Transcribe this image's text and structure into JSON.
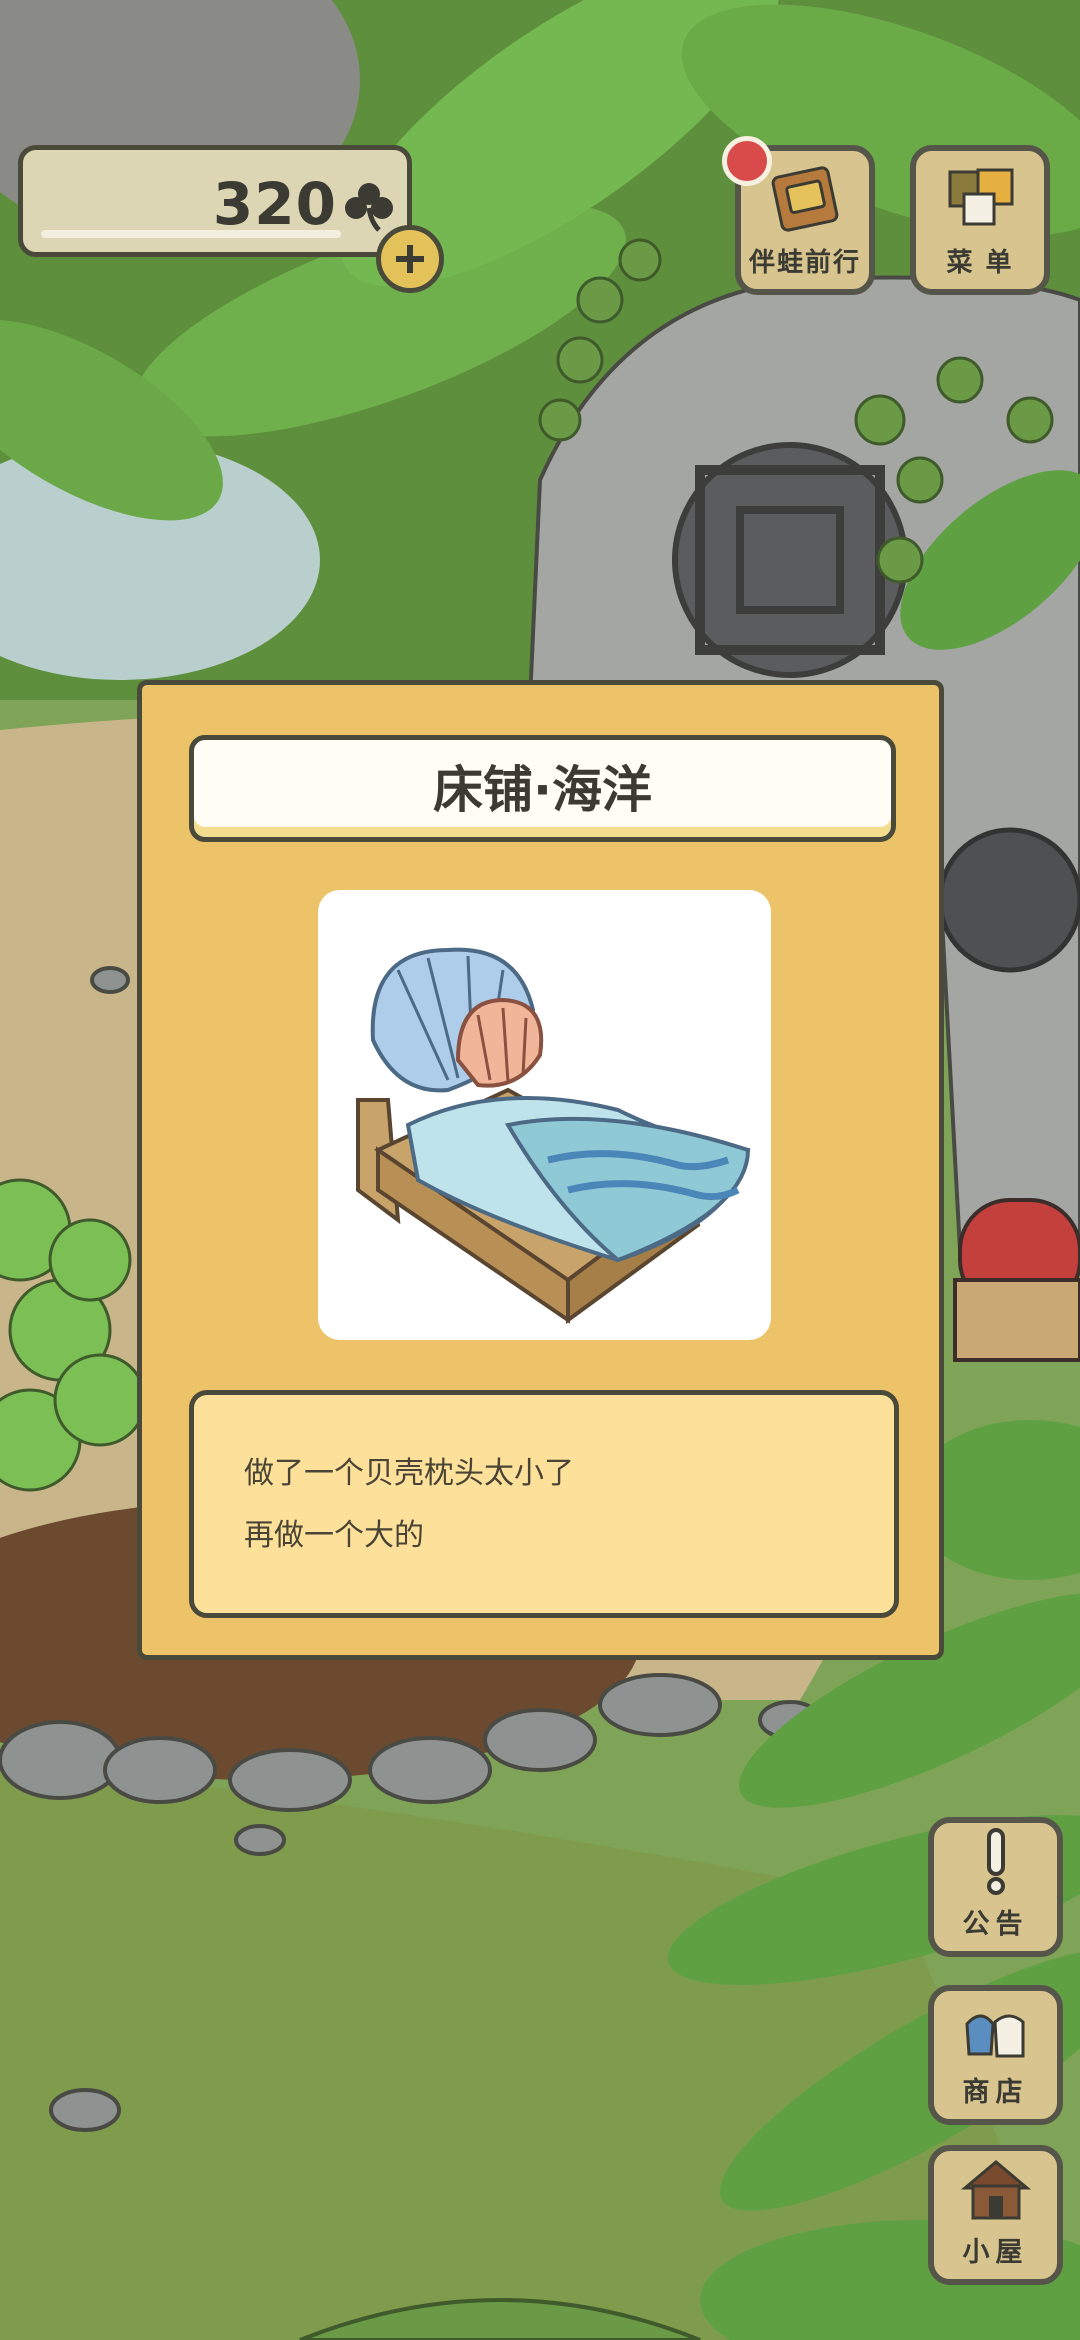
{
  "hud": {
    "clover_count": "320",
    "clover_icon": "clover-icon",
    "add_icon": "plus-icon"
  },
  "top_buttons": {
    "travel_label": "伴蛙前行",
    "menu_label": "菜 单",
    "notification_color": "#d94a4a"
  },
  "side_buttons": {
    "notice_label": "公告",
    "shop_label": "商店",
    "house_label": "小屋"
  },
  "item": {
    "title": "床铺·海洋",
    "image_icon": "shell-bed-illustration",
    "description": [
      "做了一个贝壳枕头太小了",
      "再做一个大的"
    ]
  },
  "colors": {
    "dialog_bg": "#edc36a",
    "desc_bg": "#fde09a",
    "button_bg": "#d8c48e"
  }
}
